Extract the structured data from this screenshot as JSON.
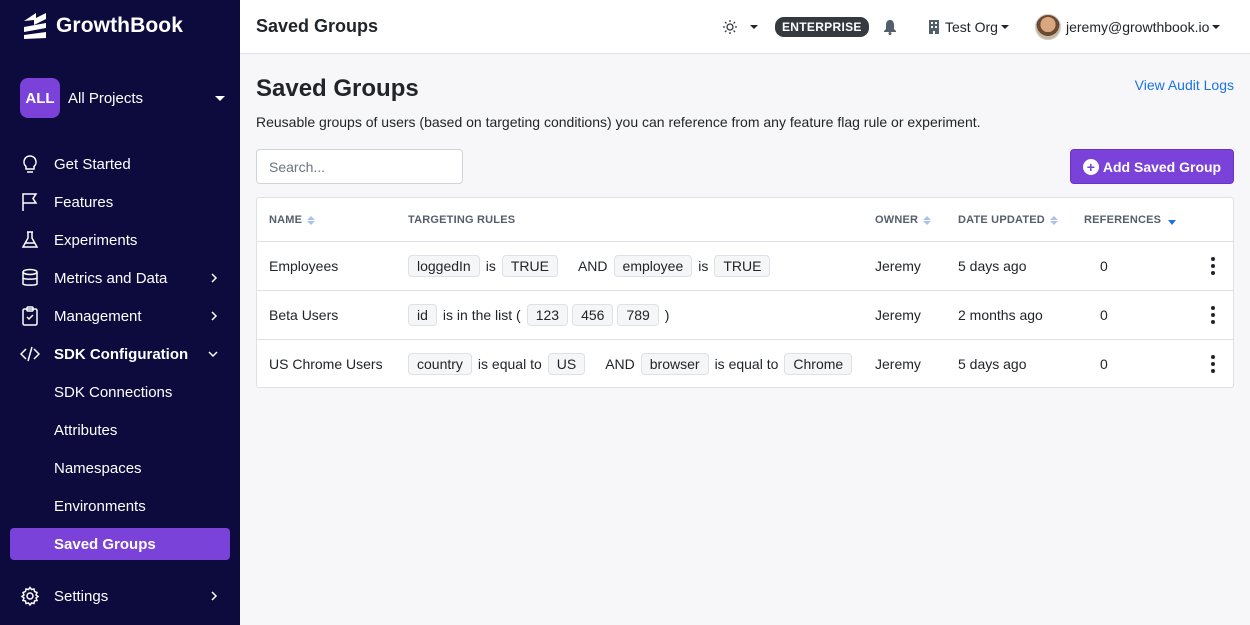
{
  "app": {
    "name": "GrowthBook"
  },
  "project": {
    "badge": "ALL",
    "label": "All Projects"
  },
  "nav": {
    "get_started": "Get Started",
    "features": "Features",
    "experiments": "Experiments",
    "metrics": "Metrics and Data",
    "management": "Management",
    "sdk_config": "SDK Configuration",
    "sdk_connections": "SDK Connections",
    "attributes": "Attributes",
    "namespaces": "Namespaces",
    "environments": "Environments",
    "saved_groups": "Saved Groups",
    "settings": "Settings"
  },
  "topbar": {
    "title": "Saved Groups",
    "plan_badge": "ENTERPRISE",
    "org": "Test Org",
    "user": "jeremy@growthbook.io"
  },
  "page": {
    "title": "Saved Groups",
    "audit_link": "View Audit Logs",
    "subtitle": "Reusable groups of users (based on targeting conditions) you can reference from any feature flag rule or experiment.",
    "search_placeholder": "Search...",
    "add_button": "Add Saved Group"
  },
  "table": {
    "headers": {
      "name": "NAME",
      "rules": "TARGETING RULES",
      "owner": "OWNER",
      "date": "DATE UPDATED",
      "refs": "REFERENCES"
    },
    "rows": [
      {
        "name": "Employees",
        "owner": "Jeremy",
        "date": "5 days ago",
        "refs": "0",
        "r": {
          "a": "loggedIn",
          "b": "is",
          "c": "TRUE",
          "and": "AND",
          "d": "employee",
          "e": "is",
          "f": "TRUE"
        }
      },
      {
        "name": "Beta Users",
        "owner": "Jeremy",
        "date": "2 months ago",
        "refs": "0",
        "r": {
          "a": "id",
          "b": "is in the list (",
          "v1": "123",
          "v2": "456",
          "v3": "789",
          "close": ")"
        }
      },
      {
        "name": "US Chrome Users",
        "owner": "Jeremy",
        "date": "5 days ago",
        "refs": "0",
        "r": {
          "a": "country",
          "b": "is equal to",
          "c": "US",
          "and": "AND",
          "d": "browser",
          "e": "is equal to",
          "f": "Chrome"
        }
      }
    ]
  },
  "colors": {
    "sidebar_bg": "#0d0b3e",
    "accent": "#7b42d9",
    "link": "#1a73e8"
  }
}
